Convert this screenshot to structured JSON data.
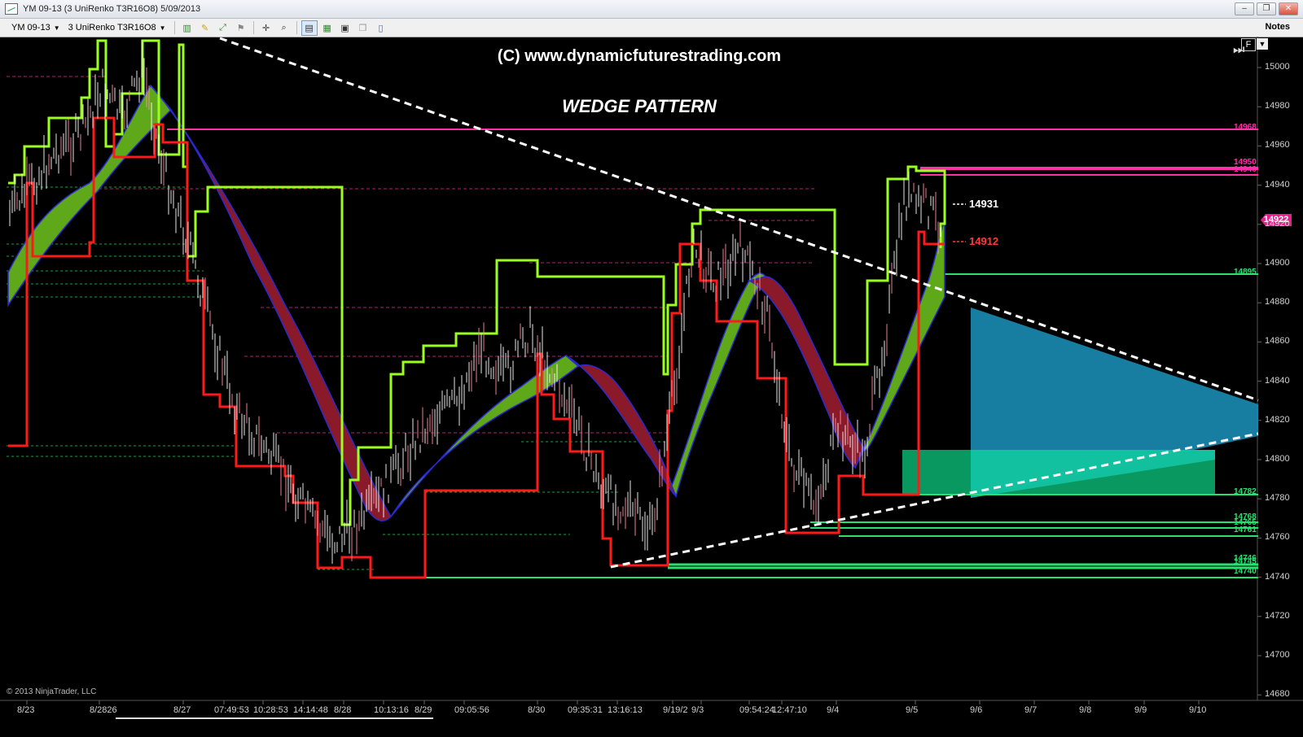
{
  "window": {
    "title": "YM 09-13 (3 UniRenko T3R16O8)  5/09/2013",
    "minimize": "–",
    "restore": "❐",
    "close": "✕"
  },
  "toolbar": {
    "instrument": "YM 09-13",
    "period": "3 UniRenko T3R16O8",
    "notes": "Notes"
  },
  "chart": {
    "watermark": "(C) www.dynamicfuturestrading.com",
    "pattern_title": "WEDGE PATTERN",
    "copyright": "© 2013 NinjaTrader, LLC",
    "f_button": "F",
    "current_price": "14922",
    "callout_high": "14931",
    "callout_low": "14912",
    "price_axis": [
      "15000",
      "14980",
      "14960",
      "14940",
      "14920",
      "14900",
      "14880",
      "14860",
      "14840",
      "14820",
      "14800",
      "14780",
      "14760",
      "14740",
      "14720",
      "14700",
      "14680"
    ],
    "time_axis": [
      "8/23",
      "8/2826",
      "8/27",
      "07:49:53",
      "10:28:53",
      "14:14:48",
      "8/28",
      "10:13:16",
      "8/29",
      "09:05:56",
      "8/30",
      "09:35:31",
      "13:16:13",
      "9/19/2",
      "9/3",
      "09:54:24",
      "12:47:10",
      "9/4",
      "9/5",
      "9/6",
      "9/7",
      "9/8",
      "9/9",
      "9/10"
    ],
    "level_tags": [
      {
        "label": "14968",
        "color": "#ff2fa8"
      },
      {
        "label": "14950",
        "color": "#ff2fa8"
      },
      {
        "label": "14946",
        "color": "#ff2fa8"
      },
      {
        "label": "14895",
        "color": "#28e070"
      },
      {
        "label": "14782",
        "color": "#28e070"
      },
      {
        "label": "14768",
        "color": "#28e070"
      },
      {
        "label": "14765",
        "color": "#28e070"
      },
      {
        "label": "14761",
        "color": "#28e070"
      },
      {
        "label": "14746",
        "color": "#28e070"
      },
      {
        "label": "14745",
        "color": "#28e070"
      },
      {
        "label": "14740",
        "color": "#28e070"
      }
    ],
    "colors": {
      "background": "#000000",
      "upper_band": "#9aff1f",
      "lower_band": "#ff1a1a",
      "cloud_up": "#5ea81a",
      "cloud_down": "#8a1a2a",
      "trendline": "#ffffff",
      "resistance": "#ff2fa8",
      "support": "#28e070",
      "target_zone": "#1a8fb8",
      "entry_zone": "#0aa86a"
    }
  }
}
